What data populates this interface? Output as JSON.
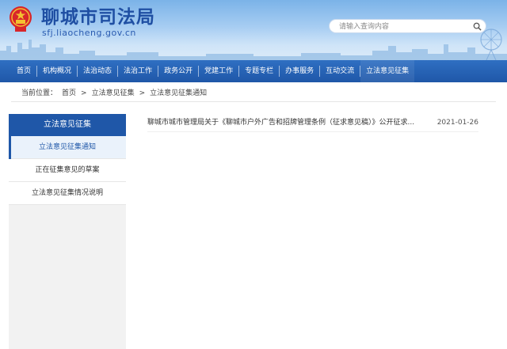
{
  "site": {
    "title": "聊城市司法局",
    "url": "sfj.liaocheng.gov.cn"
  },
  "search": {
    "placeholder": "请输入查询内容"
  },
  "nav": {
    "items": [
      {
        "label": "首页"
      },
      {
        "label": "机构概况"
      },
      {
        "label": "法治动态"
      },
      {
        "label": "法治工作"
      },
      {
        "label": "政务公开"
      },
      {
        "label": "党建工作"
      },
      {
        "label": "专题专栏"
      },
      {
        "label": "办事服务"
      },
      {
        "label": "互动交流"
      },
      {
        "label": "立法意见征集"
      }
    ]
  },
  "breadcrumb": {
    "prefix": "当前位置：",
    "home": "首页",
    "sep": ">",
    "section": "立法意见征集",
    "current": "立法意见征集通知"
  },
  "sidebar": {
    "header": "立法意见征集",
    "items": [
      {
        "label": "立法意见征集通知",
        "active": true
      },
      {
        "label": "正在征集意见的草案",
        "active": false
      },
      {
        "label": "立法意见征集情况说明",
        "active": false
      }
    ]
  },
  "list": {
    "rows": [
      {
        "title": "聊城市城市管理局关于《聊城市户外广告和招牌管理条例（征求意见稿）》公开征求...",
        "date": "2021-01-26"
      }
    ]
  },
  "colors": {
    "brand_blue": "#1f57a8",
    "nav_blue": "#2f6fc2",
    "title_blue": "#1f4fa3"
  }
}
